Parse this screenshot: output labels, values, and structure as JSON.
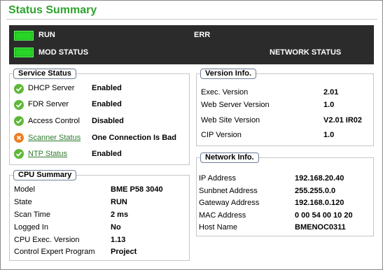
{
  "page": {
    "title": "Status Summary"
  },
  "status_bar": {
    "run": "RUN",
    "err": "ERR",
    "mod_status": "MOD STATUS",
    "network_status": "NETWORK STATUS",
    "led_color": "#27d627",
    "background": "#2b2b2b"
  },
  "service_status": {
    "title": "Service Status",
    "items": [
      {
        "label": "DHCP Server",
        "value": "Enabled",
        "icon": "check-icon",
        "link": false
      },
      {
        "label": "FDR Server",
        "value": "Enabled",
        "icon": "check-icon",
        "link": false
      },
      {
        "label": "Access Control",
        "value": "Disabled",
        "icon": "check-icon",
        "link": false
      },
      {
        "label": "Scanner Status",
        "value": "One Connection Is Bad",
        "icon": "error-icon",
        "link": true
      },
      {
        "label": "NTP Status",
        "value": "Enabled",
        "icon": "check-icon",
        "link": true
      }
    ]
  },
  "cpu_summary": {
    "title": "CPU Summary",
    "items": [
      {
        "label": "Model",
        "value": "BME P58 3040"
      },
      {
        "label": "State",
        "value": "RUN"
      },
      {
        "label": "Scan Time",
        "value": "2 ms"
      },
      {
        "label": "Logged In",
        "value": "No"
      },
      {
        "label": "CPU Exec. Version",
        "value": "1.13"
      },
      {
        "label": "Control Expert Program",
        "value": "Project"
      }
    ]
  },
  "version_info": {
    "title": "Version Info.",
    "items": [
      {
        "label": "Exec. Version",
        "value": "2.01"
      },
      {
        "label": "Web Server Version",
        "value": "1.0"
      },
      {
        "label": "Web Site Version",
        "value": "V2.01 IR02"
      },
      {
        "label": "CIP Version",
        "value": "1.0"
      }
    ]
  },
  "network_info": {
    "title": "Network Info.",
    "items": [
      {
        "label": "IP Address",
        "value": "192.168.20.40"
      },
      {
        "label": "Sunbnet Address",
        "value": "255.255.0.0"
      },
      {
        "label": "Gateway Address",
        "value": "192.168.0.120"
      },
      {
        "label": "MAC Address",
        "value": "0 00 54 00 10 20"
      },
      {
        "label": "Host Name",
        "value": "BMENOC0311"
      }
    ]
  },
  "colors": {
    "accent": "#2ea32e",
    "ok": "#5db837",
    "error": "#ef7d22",
    "link": "#2f7a2f"
  }
}
